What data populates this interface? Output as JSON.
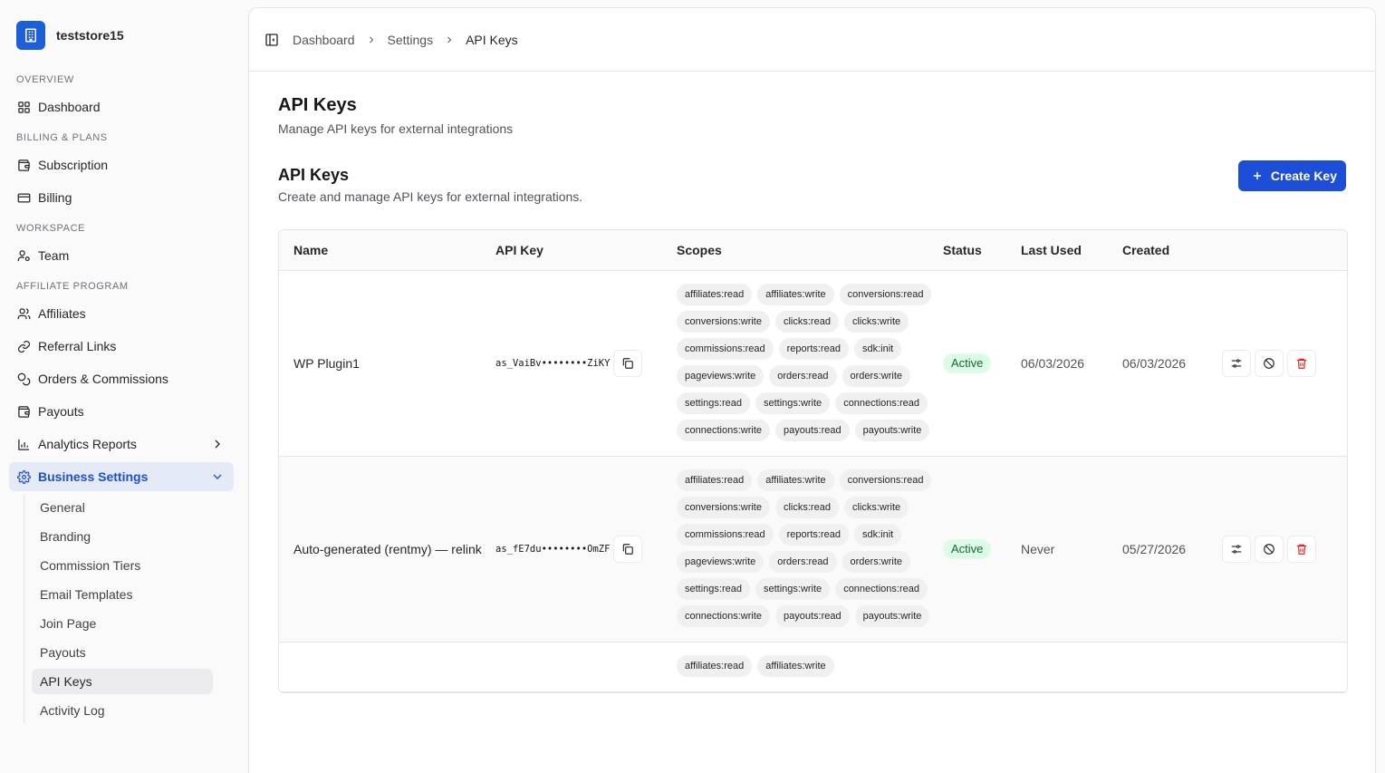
{
  "store": {
    "name": "teststore15",
    "logo_icon": "building-icon",
    "logo_color": "#1d5fd8"
  },
  "sidebar": {
    "sections": [
      {
        "label": "OVERVIEW",
        "items": [
          {
            "label": "Dashboard",
            "icon": "grid-icon"
          }
        ]
      },
      {
        "label": "BILLING & PLANS",
        "items": [
          {
            "label": "Subscription",
            "icon": "wallet-icon"
          },
          {
            "label": "Billing",
            "icon": "credit-card-icon"
          }
        ]
      },
      {
        "label": "WORKSPACE",
        "items": [
          {
            "label": "Team",
            "icon": "user-cog-icon"
          }
        ]
      },
      {
        "label": "AFFILIATE PROGRAM",
        "items": [
          {
            "label": "Affiliates",
            "icon": "users-icon"
          },
          {
            "label": "Referral Links",
            "icon": "link-icon"
          },
          {
            "label": "Orders & Commissions",
            "icon": "coins-icon"
          },
          {
            "label": "Payouts",
            "icon": "wallet-icon"
          },
          {
            "label": "Analytics Reports",
            "icon": "bar-chart-icon"
          },
          {
            "label": "Business Settings",
            "icon": "gear-icon"
          }
        ]
      }
    ],
    "business_settings_sub": [
      "General",
      "Branding",
      "Commission Tiers",
      "Email Templates",
      "Join Page",
      "Payouts",
      "API Keys",
      "Activity Log"
    ],
    "active_sub": "API Keys",
    "accent_color": "#1d4ed8"
  },
  "breadcrumb": [
    "Dashboard",
    "Settings",
    "API Keys"
  ],
  "page": {
    "title": "API Keys",
    "subtitle": "Manage API keys for external integrations"
  },
  "section": {
    "title": "API Keys",
    "subtitle": "Create and manage API keys for external integrations.",
    "create_label": "Create Key"
  },
  "table": {
    "columns": [
      "Name",
      "API Key",
      "Scopes",
      "Status",
      "Last Used",
      "Created"
    ],
    "rows": [
      {
        "name": "WP Plugin1",
        "key": "as_VaiBv••••••••ZiKY",
        "scopes": [
          "affiliates:read",
          "affiliates:write",
          "conversions:read",
          "conversions:write",
          "clicks:read",
          "clicks:write",
          "commissions:read",
          "reports:read",
          "sdk:init",
          "pageviews:write",
          "orders:read",
          "orders:write",
          "settings:read",
          "settings:write",
          "connections:read",
          "connections:write",
          "payouts:read",
          "payouts:write"
        ],
        "status": "Active",
        "last_used": "06/03/2026",
        "created": "06/03/2026"
      },
      {
        "name": "Auto-generated (rentmy) — relink",
        "key": "as_fE7du••••••••OmZF",
        "scopes": [
          "affiliates:read",
          "affiliates:write",
          "conversions:read",
          "conversions:write",
          "clicks:read",
          "clicks:write",
          "commissions:read",
          "reports:read",
          "sdk:init",
          "pageviews:write",
          "orders:read",
          "orders:write",
          "settings:read",
          "settings:write",
          "connections:read",
          "connections:write",
          "payouts:read",
          "payouts:write"
        ],
        "status": "Active",
        "last_used": "Never",
        "created": "05/27/2026"
      },
      {
        "name": "",
        "key": "",
        "scopes": [
          "affiliates:read",
          "affiliates:write"
        ],
        "status": "",
        "last_used": "",
        "created": ""
      }
    ],
    "status_colors": {
      "active_bg": "#dcfce7",
      "active_text": "#166534"
    },
    "action_icons": [
      "sliders-icon",
      "ban-icon",
      "trash-icon"
    ]
  }
}
